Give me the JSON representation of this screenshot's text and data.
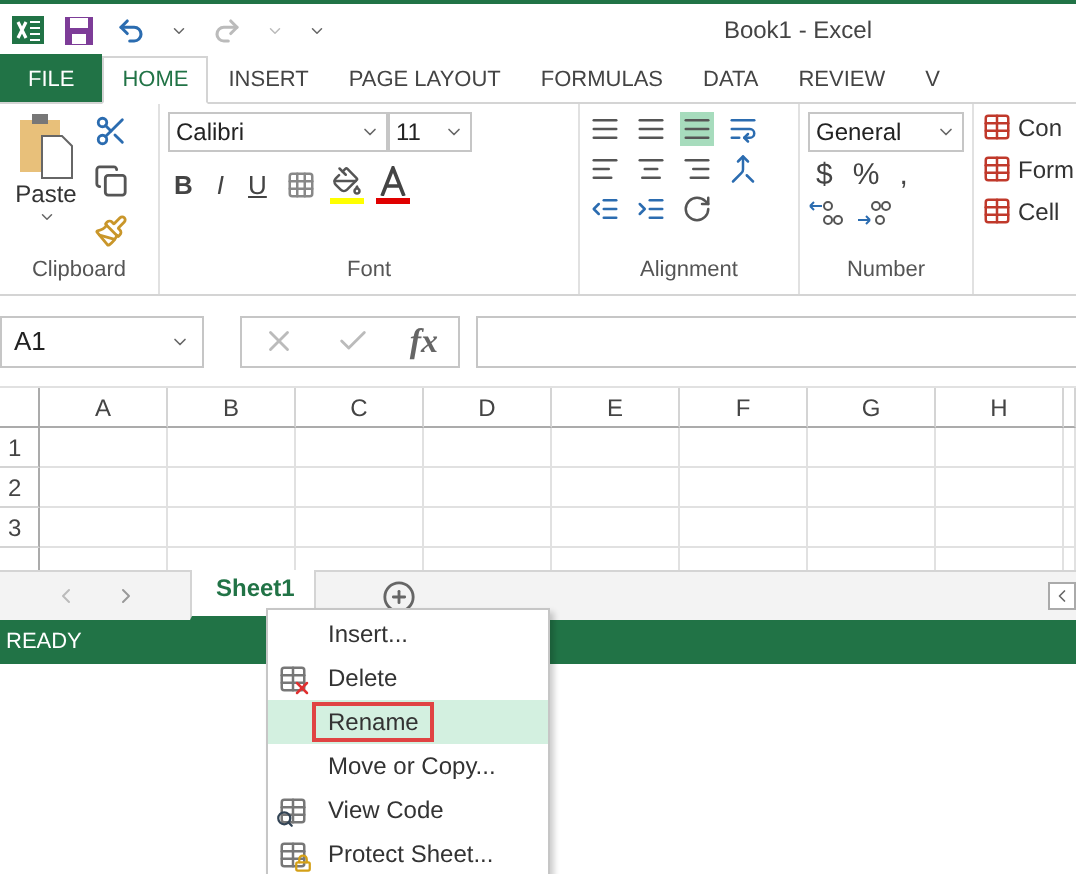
{
  "title": "Book1 - Excel",
  "ribbon_tabs": [
    {
      "label": "FILE",
      "kind": "file",
      "selected": false
    },
    {
      "label": "HOME",
      "kind": "tab",
      "selected": true
    },
    {
      "label": "INSERT",
      "kind": "tab",
      "selected": false
    },
    {
      "label": "PAGE LAYOUT",
      "kind": "tab",
      "selected": false
    },
    {
      "label": "FORMULAS",
      "kind": "tab",
      "selected": false
    },
    {
      "label": "DATA",
      "kind": "tab",
      "selected": false
    },
    {
      "label": "REVIEW",
      "kind": "tab",
      "selected": false
    },
    {
      "label": "V",
      "kind": "tab",
      "selected": false
    }
  ],
  "clipboard": {
    "label": "Clipboard",
    "paste": "Paste"
  },
  "font": {
    "label": "Font",
    "name": "Calibri",
    "size": "11",
    "bold": "B",
    "italic": "I",
    "underline": "U"
  },
  "alignment": {
    "label": "Alignment"
  },
  "number": {
    "label": "Number",
    "format": "General",
    "currency": "$",
    "percent": "%",
    "comma": ","
  },
  "styles": [
    "Con",
    "Form",
    "Cell"
  ],
  "formula_bar": {
    "name_box": "A1",
    "fx": "fx"
  },
  "columns": [
    "A",
    "B",
    "C",
    "D",
    "E",
    "F",
    "G",
    "H"
  ],
  "rows": [
    "1",
    "2",
    "3"
  ],
  "sheet_tabs": [
    {
      "label": "Sheet1",
      "selected": true
    }
  ],
  "status": "READY",
  "context_menu": [
    {
      "label": "Insert...",
      "kind": "plain",
      "selected": false
    },
    {
      "label": "Delete",
      "kind": "delete",
      "selected": false
    },
    {
      "label": "Rename",
      "kind": "plain",
      "selected": true
    },
    {
      "label": "Move or Copy...",
      "kind": "plain",
      "selected": false
    },
    {
      "label": "View Code",
      "kind": "code",
      "selected": false
    },
    {
      "label": "Protect Sheet...",
      "kind": "protect",
      "selected": false
    }
  ]
}
